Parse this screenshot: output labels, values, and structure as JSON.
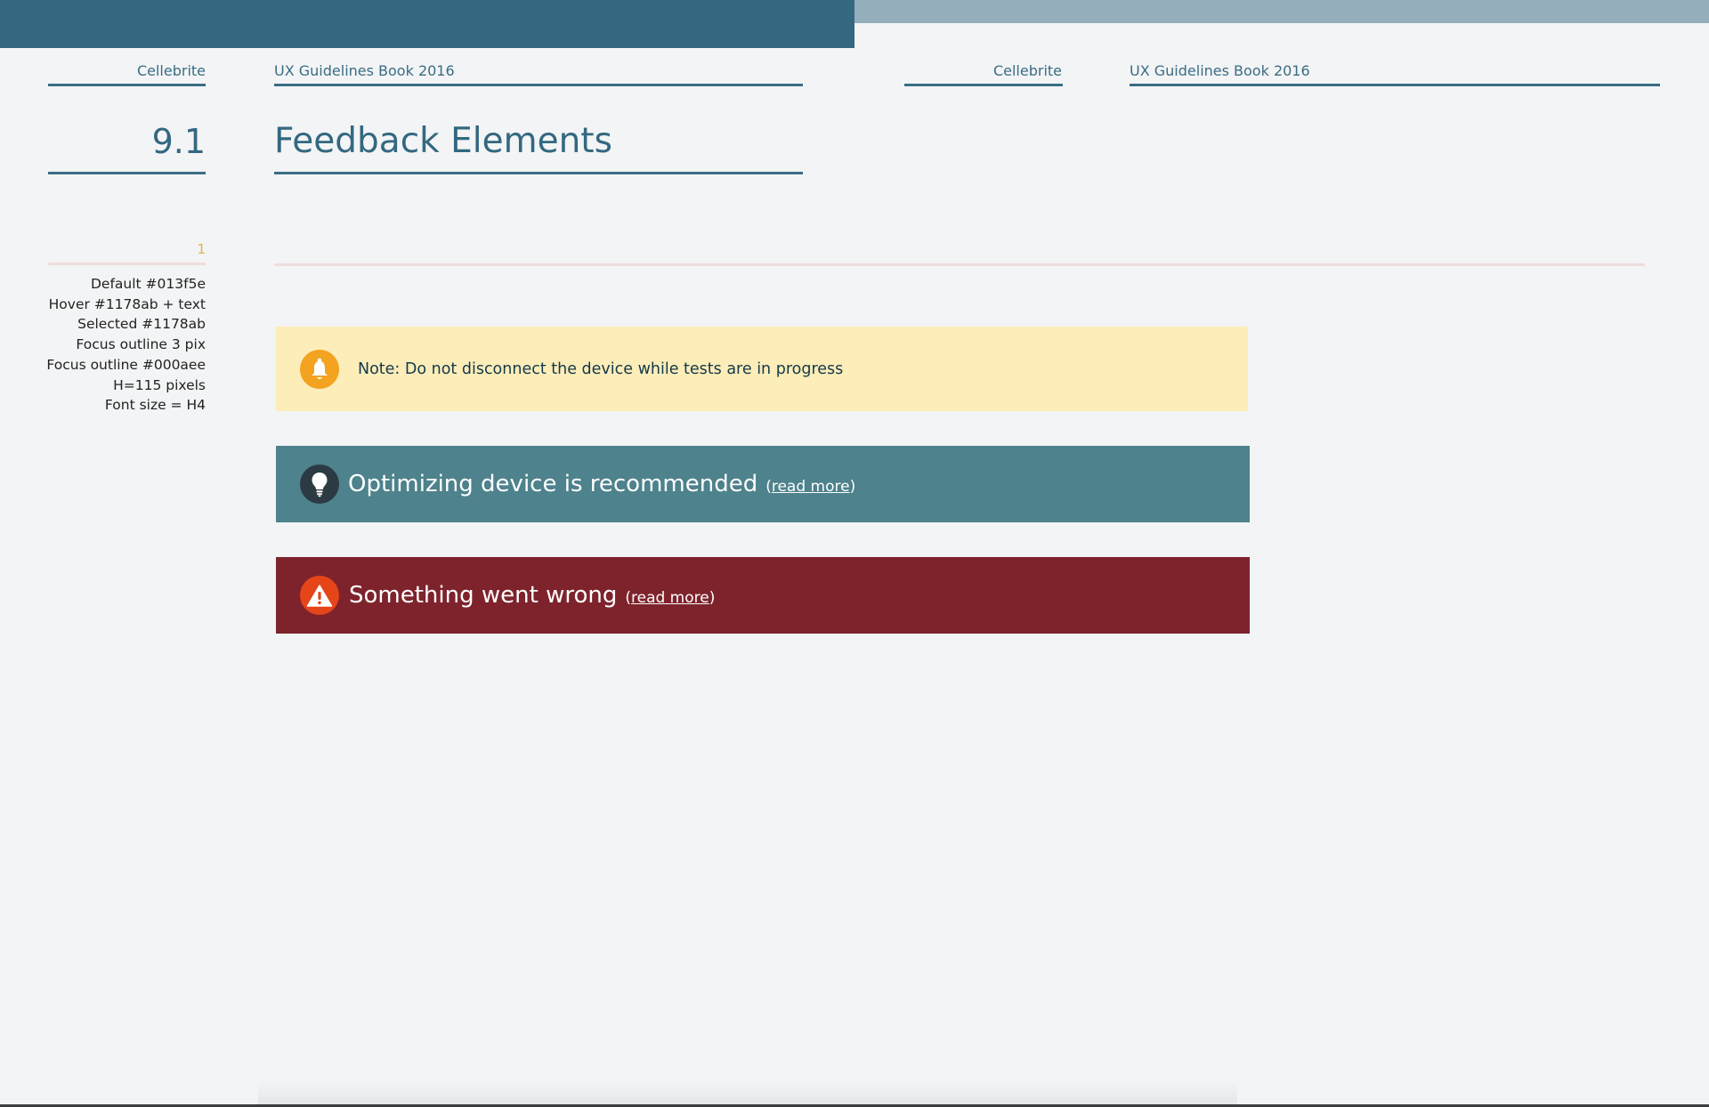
{
  "header": {
    "left": {
      "company": "Cellebrite",
      "book": "UX Guidelines Book 2016"
    },
    "right": {
      "company": "Cellebrite",
      "book": "UX Guidelines Book 2016"
    }
  },
  "section": {
    "number": "9.1",
    "title": "Feedback Elements"
  },
  "note_number": "1",
  "specs": [
    "Default #013f5e",
    "Hover #1178ab + text",
    "Selected #1178ab",
    "Focus outline 3 pix",
    "Focus outline #000aee",
    "H=115 pixels",
    "Font size = H4"
  ],
  "banners": {
    "note": {
      "text": "Note: Do not disconnect the device while tests are in progress",
      "icon": "bell-icon"
    },
    "info": {
      "text": "Optimizing device is recommended",
      "open_paren": "(",
      "link": "read more",
      "close_paren": ")",
      "icon": "lightbulb-icon"
    },
    "error": {
      "text": "Something went wrong",
      "open_paren": "(",
      "link": "read more",
      "close_paren": ")",
      "icon": "warning-icon"
    }
  },
  "colors": {
    "top_bar": "#336880",
    "top_bar_right": "#94aebb",
    "note_bg": "#fcedb9",
    "info_bg": "#4e828c",
    "error_bg": "#7e232c",
    "accent_text": "#336880"
  }
}
